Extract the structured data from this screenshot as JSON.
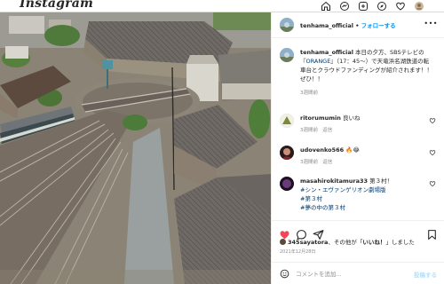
{
  "app": {
    "logo": "Instagram",
    "nav_icons": [
      "home-icon",
      "messenger-icon",
      "new-post-icon",
      "explore-icon",
      "activity-heart-icon",
      "profile-avatar"
    ]
  },
  "photo": {
    "subject": "aerial-rail-roundhouse",
    "icon": "post-image"
  },
  "post": {
    "username": "tenhama_official",
    "separator": " • ",
    "follow_label": "フォローする",
    "more_icon": "more-options-icon",
    "more_label": "•••",
    "caption": {
      "username": "tenhama_official",
      "text_before": " 本日の夕方、SBSテレビの『",
      "text_link": "ORANGE",
      "text_after": "』（17：45～）で天竜浜名湖鉄道の転車台とクラウドファンディングが紹介されます！！ぜひ！！",
      "time": "3週間前"
    }
  },
  "comments": [
    {
      "username": "ritorumumin",
      "text": " 良いね",
      "time": "3週間前",
      "reply": "返信"
    },
    {
      "username": "udovenko566",
      "text": " 🔥😂",
      "time": "3週間前",
      "reply": "返信"
    },
    {
      "username": "masahirokitamura33",
      "text": " 第３村！",
      "tags": [
        "#シン・エヴァンゲリオン劇場版",
        "#第３村",
        "#夢の中の第３村"
      ],
      "time": "3週間前",
      "reply": "返信"
    }
  ],
  "actions": {
    "icons": [
      "like-heart-icon",
      "comment-icon",
      "share-icon",
      "save-bookmark-icon"
    ]
  },
  "likes": {
    "user": "345sayatora",
    "text_mid": "、その他",
    "quote_open": "が「",
    "quote_word": "いいね！",
    "quote_close": "」しました"
  },
  "date": "2021年12月28日",
  "composer": {
    "placeholder": "コメントを追加...",
    "post_label": "投稿する",
    "emoji_icon": "emoji-smile-icon"
  },
  "colors": {
    "accent": "#0095f6",
    "liked_heart": "#ed4956",
    "link": "#00376b",
    "muted": "#8e8e8e",
    "post_disabled": "#b2dffc"
  }
}
